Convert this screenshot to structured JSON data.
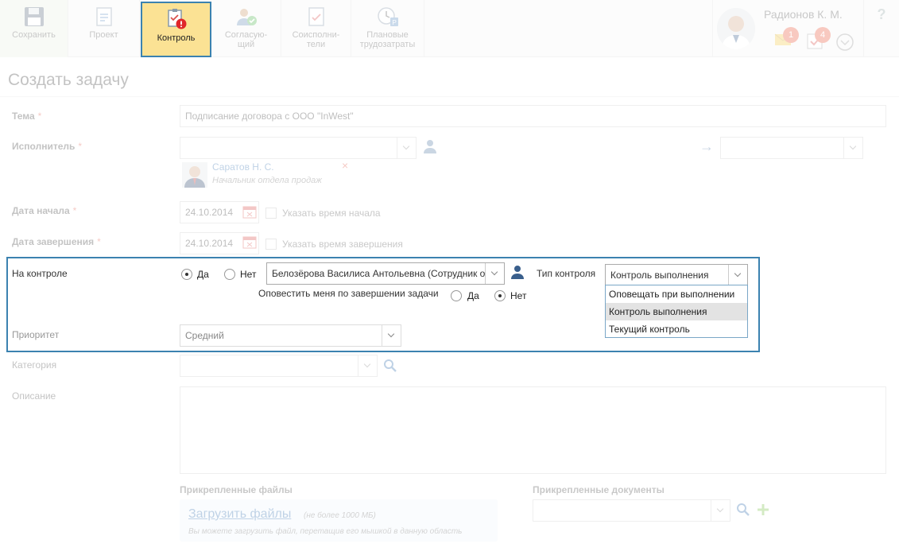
{
  "toolbar": {
    "save_label": "Сохранить",
    "project_label": "Проект",
    "control_label": "Контроль",
    "sogl_label_1": "Согласую-",
    "sogl_label_2": "щий",
    "coisp_label_1": "Соисполни-",
    "coisp_label_2": "тели",
    "plan_label_1": "Плановые",
    "plan_label_2": "трудозатраты"
  },
  "user": {
    "name": "Радионов К. М.",
    "mail_count": "1",
    "task_count": "4",
    "help": "?"
  },
  "page": {
    "title": "Создать задачу"
  },
  "form": {
    "topic_label": "Тема",
    "topic_value": "Подписание договора с ООО \"InWest\"",
    "executor_label": "Исполнитель",
    "executor_value": "",
    "executor_person_name": "Саратов Н. С.",
    "executor_person_role": "Начальник отдела продаж",
    "executor_remove": "×",
    "arrow": "→",
    "start_label": "Дата начала",
    "start_value": "24.10.2014",
    "start_time_label": "Указать время начала",
    "end_label": "Дата завершения",
    "end_value": "24.10.2014",
    "end_time_label": "Указать время завершения",
    "required_mark": "*"
  },
  "control": {
    "label": "На контроле",
    "yes": "Да",
    "no": "Нет",
    "selected": "yes",
    "controller": "Белозёрова Василиса Антольевна (Сотрудник о",
    "control_type_label": "Тип контроля",
    "control_type_value": "Контроль выполнения",
    "notify_label": "Оповестить меня по завершении задачи",
    "notify_yes": "Да",
    "notify_no": "Нет",
    "notify_selected": "no",
    "options": [
      "Оповещать при выполнении",
      "Контроль выполнения",
      "Текущий контроль"
    ],
    "selected_option": "Контроль выполнения",
    "priority_label": "Приоритет",
    "priority_value": "Средний"
  },
  "rest": {
    "category_label": "Категория",
    "description_label": "Описание",
    "files_label": "Прикрепленные файлы",
    "docs_label": "Прикрепленные документы",
    "upload_link": "Загрузить файлы",
    "upload_limit": "(не более 1000 МБ)",
    "upload_hint": "Вы можете загрузить файл, перетащив его мышкой в данную область"
  },
  "colors": {
    "highlight_border": "#3b82b0",
    "control_button_bg": "#fbe294",
    "required": "#e05a4a",
    "badge": "#e8583c",
    "green_plus": "#7bc24a"
  }
}
